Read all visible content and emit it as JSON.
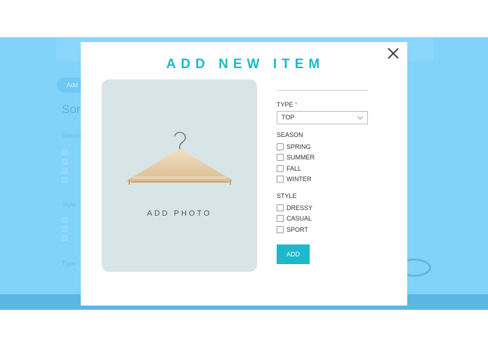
{
  "modal": {
    "title": "ADD NEW ITEM",
    "photo_label": "ADD PHOTO",
    "type": {
      "label": "TYPE",
      "required_mark": "*",
      "selected": "TOP"
    },
    "season": {
      "label": "SEASON",
      "options": [
        "SPRING",
        "SUMMER",
        "FALL",
        "WINTER"
      ]
    },
    "style": {
      "label": "STYLE",
      "options": [
        "DRESSY",
        "CASUAL",
        "SPORT"
      ]
    },
    "add_button_label": "ADD"
  },
  "background": {
    "add_button_label": "Add",
    "heading": "Sort",
    "labels": [
      "Season",
      "Style",
      "Type"
    ]
  },
  "colors": {
    "accent": "#1db8c9",
    "app_background": "#82d3fa",
    "photo_panel": "#d7e5e6"
  },
  "icons": [
    "close-icon",
    "hanger-icon",
    "chevron-down-icon"
  ]
}
